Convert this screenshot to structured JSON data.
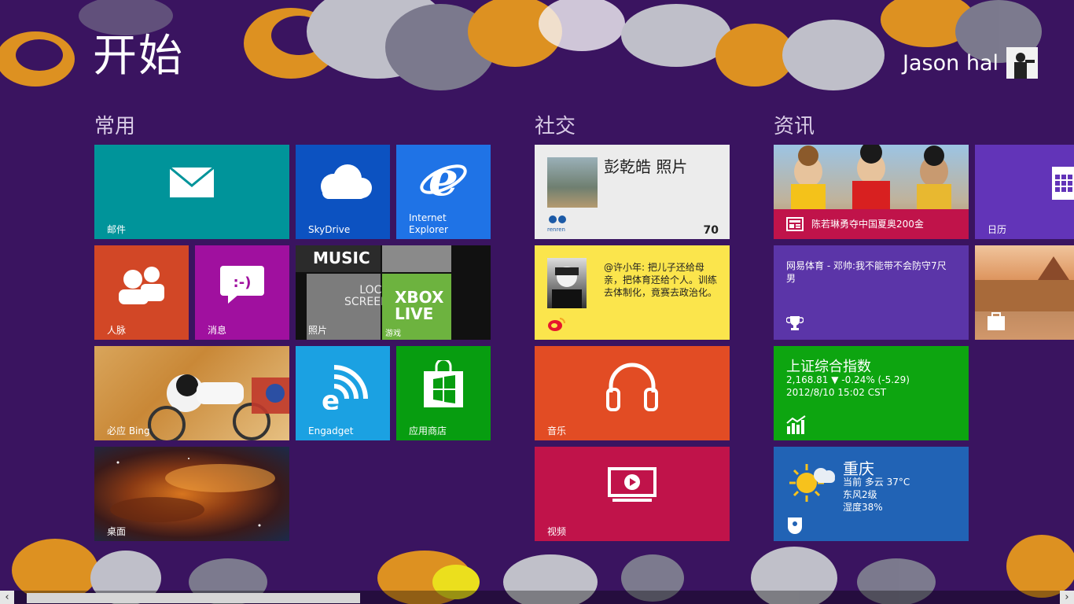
{
  "start": {
    "title": "开始"
  },
  "user": {
    "name": "Jason hal"
  },
  "groups": {
    "common": "常用",
    "social": "社交",
    "news": "资讯"
  },
  "tiles": {
    "mail": {
      "label": "邮件"
    },
    "skydrive": {
      "label": "SkyDrive"
    },
    "ie": {
      "line1": "Internet",
      "line2": "Explorer"
    },
    "people": {
      "label": "人脉"
    },
    "messaging": {
      "label": "消息"
    },
    "photos": {
      "label": "照片",
      "music_text": "MUSIC",
      "xbox_line1": "XBOX",
      "xbox_line2": "LIVE",
      "games_text": "游戏",
      "lock_text1": "LOCK",
      "lock_text2": "SCREEN"
    },
    "bing": {
      "label": "必应 Bing"
    },
    "engadget": {
      "label": "Engadget"
    },
    "store": {
      "label": "应用商店"
    },
    "desktop": {
      "label": "桌面"
    },
    "renren": {
      "title": "彭乾皓 照片",
      "count": "70",
      "logo_text": "renren"
    },
    "weibo": {
      "text": "@许小年: 把儿子还给母亲，把体育还给个人。训练去体制化，竟赛去政治化。"
    },
    "music": {
      "label": "音乐"
    },
    "video": {
      "label": "视频"
    },
    "news_photo": {
      "caption": "陈若琳勇夺中国夏奥200金"
    },
    "calendar": {
      "label": "日历"
    },
    "sports": {
      "text": "网易体育 - 邓帅:我不能带不会防守7尺男"
    },
    "finance": {
      "title": "上证综合指数",
      "value": "2,168.81  ▼ -0.24% (-5.29)",
      "time": "2012/8/10 15:02 CST"
    },
    "weather": {
      "city": "重庆",
      "line1": "当前 多云 37°C",
      "line2": "东风2级",
      "line3": "湿度38%"
    }
  },
  "colors": {
    "background": "#3a1460",
    "mail": "#00949a",
    "skydrive": "#0c52c1",
    "ie": "#1f73e6",
    "people": "#d24726",
    "messaging": "#a0109f",
    "engadget": "#1ba1e2",
    "store": "#079d10",
    "renren": "#ececec",
    "weibo": "#fbe54c",
    "music": "#e24c24",
    "video": "#c0134a",
    "calendar": "#6234b8",
    "sports": "#5b35a8",
    "finance": "#0da510",
    "weather": "#2163b5"
  }
}
